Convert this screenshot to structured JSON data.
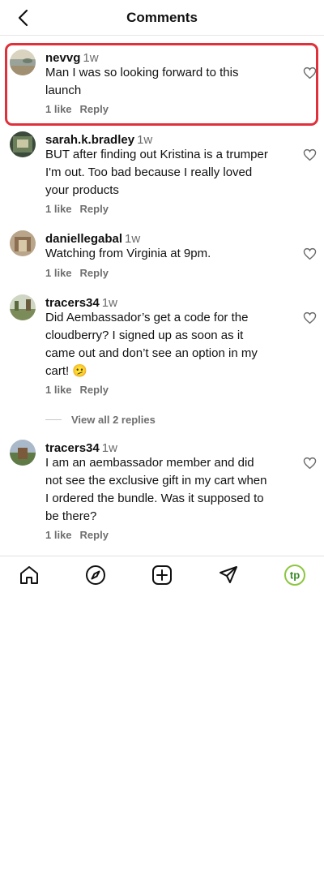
{
  "header": {
    "title": "Comments",
    "back_icon": "chevron-left-icon"
  },
  "comments": [
    {
      "username": "nevvg",
      "time": "1w",
      "text": "Man I was so looking forward to this\nlaunch",
      "likes": "1 like",
      "reply": "Reply",
      "highlighted": true
    },
    {
      "username": "sarah.k.bradley",
      "time": "1w",
      "text": "BUT after finding out Kristina is a trumper\nI'm out. Too bad because I really loved\nyour products",
      "likes": "1 like",
      "reply": "Reply"
    },
    {
      "username": "daniellegabal",
      "time": "1w",
      "text": "Watching from Virginia at 9pm.",
      "likes": "1 like",
      "reply": "Reply"
    },
    {
      "username": "tracers34",
      "time": "1w",
      "text": "Did Aembassador’s get a code for the\ncloudberry? I signed up as soon as it\ncame out and don’t see an option in my\ncart! 🫤",
      "likes": "1 like",
      "reply": "Reply",
      "view_replies": "View all 2 replies"
    },
    {
      "username": "tracers34",
      "time": "1w",
      "text": "I am an aembassador member and did\nnot see the exclusive gift in my cart when\nI ordered the bundle. Was it supposed to\nbe there?",
      "likes": "1 like",
      "reply": "Reply"
    }
  ],
  "nav": {
    "items": [
      "home-icon",
      "explore-compass-icon",
      "create-plus-icon",
      "send-icon",
      "profile-avatar-icon"
    ],
    "profile_initials": "tp",
    "profile_color": "#8cc63f"
  },
  "colors": {
    "highlight_border": "#e0303b"
  }
}
